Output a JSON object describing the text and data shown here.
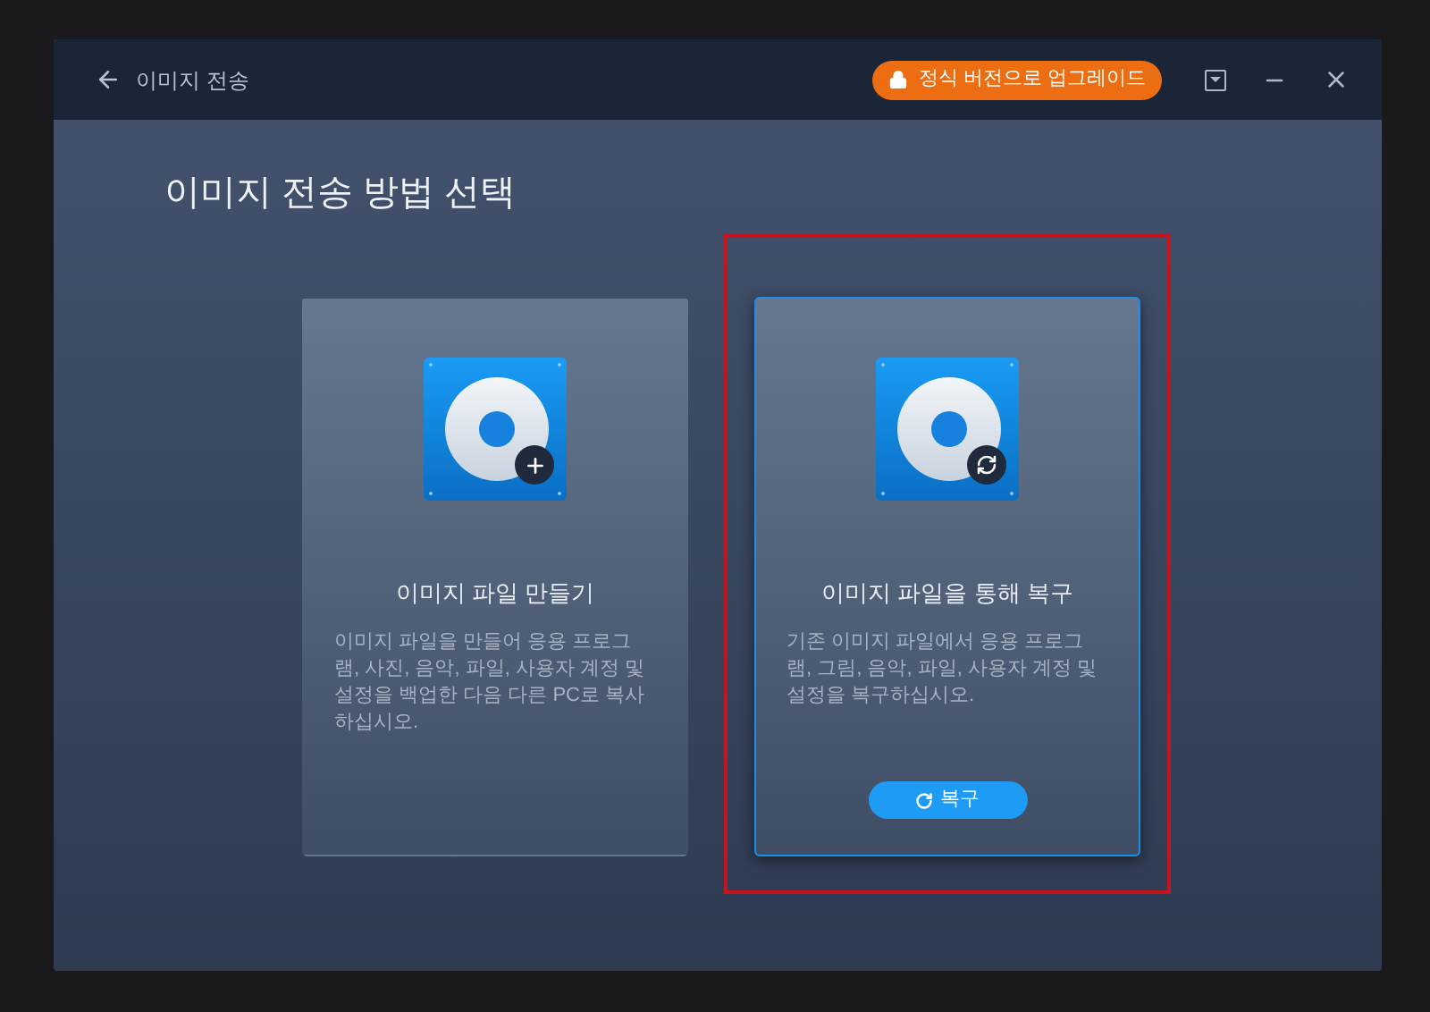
{
  "window": {
    "title": "이미지 전송"
  },
  "upgrade_button": {
    "label": "정식 버전으로 업그레이드"
  },
  "heading": "이미지 전송 방법 선택",
  "cards": [
    {
      "kind": "create",
      "title": "이미지 파일 만들기",
      "description": "이미지 파일을 만들어 응용 프로그램, 사진, 음악, 파일, 사용자 계정 및 설정을 백업한 다음 다른 PC로 복사하십시오.",
      "selected": false,
      "highlighted": false
    },
    {
      "kind": "restore",
      "title": "이미지 파일을 통해 복구",
      "description": "기존 이미지 파일에서 응용 프로그램, 그림, 음악, 파일, 사용자 계정 및 설정을 복구하십시오.",
      "selected": true,
      "highlighted": true,
      "button": "복구"
    }
  ]
}
